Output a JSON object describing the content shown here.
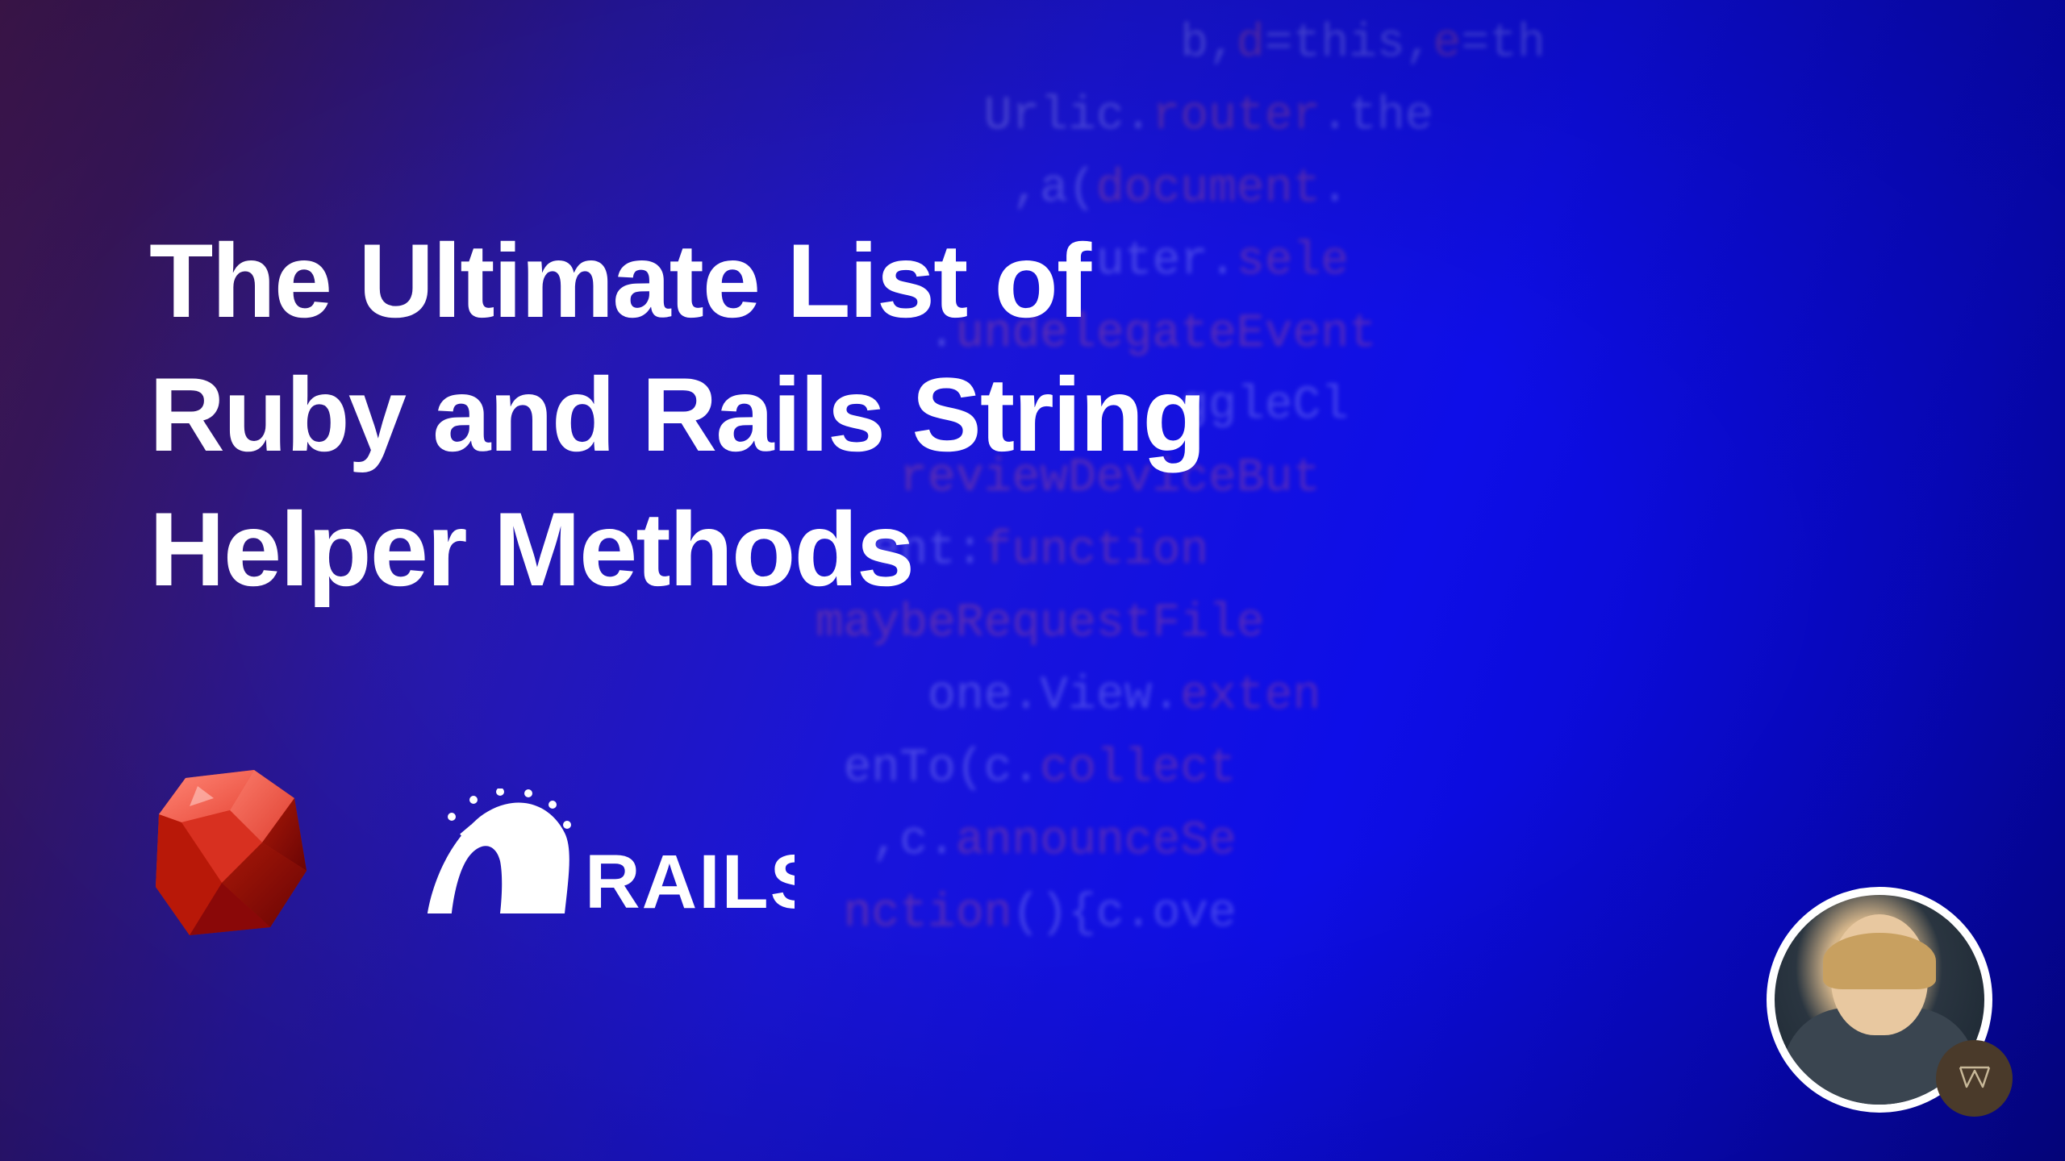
{
  "title_line1": "The Ultimate List of",
  "title_line2": "Ruby and Rails String",
  "title_line3": "Helper Methods",
  "logos": {
    "ruby": "ruby-logo",
    "rails": "RAILS"
  },
  "background_code_lines": [
    "              b,d=this,e=th",
    "       Urlic.router.the",
    "        ,a(document.",
    "           uter.sele",
    "     .undelegateEvent",
    "              ggleCl",
    "    reviewDeviceBut",
    "   ent:function",
    " maybeRequestFile",
    "     one.View.exten",
    "  enTo(c.collect",
    "   ,c.announceSe",
    "  nction(){c.ove"
  ],
  "badge_letter": "W"
}
